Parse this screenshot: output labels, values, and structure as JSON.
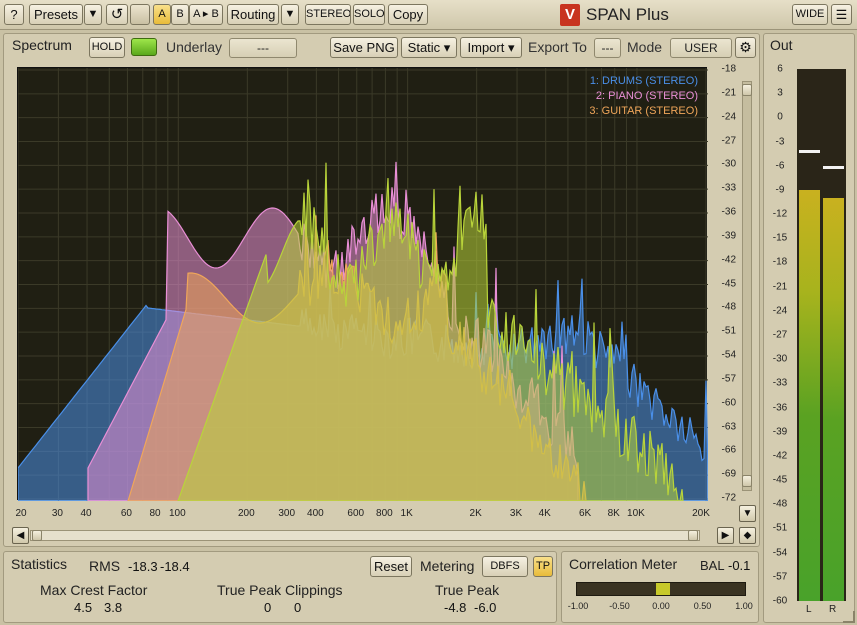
{
  "toolbar": {
    "help_label": "?",
    "presets_label": "Presets",
    "presets_dropdown": "▼",
    "undo_glyph": "↺",
    "a_label": "A",
    "b_label": "B",
    "ab_copy_label": "A ▸ B",
    "routing_label": "Routing",
    "routing_dropdown": "▼",
    "stereo_label": "STEREO",
    "solo_label": "SOLO",
    "copy_label": "Copy",
    "logo_glyph": "V",
    "app_title": "SPAN Plus",
    "wide_label": "WIDE",
    "menu_glyph": "☰"
  },
  "spectrum_panel": {
    "tab_label": "Spectrum",
    "hold_label": "HOLD",
    "underlay_label": "Underlay",
    "underlay_value": "---",
    "save_png_label": "Save PNG",
    "static_label": "Static ▾",
    "import_label": "Import ▾",
    "export_label": "Export To",
    "export_value": "---",
    "mode_label": "Mode",
    "mode_value": "USER",
    "settings_glyph": "⚙"
  },
  "legend": [
    {
      "text": "1: DRUMS (STEREO)",
      "color": "#4a8fe8"
    },
    {
      "text": "2: PIANO (STEREO)",
      "color": "#e98fd6"
    },
    {
      "text": "3: GUITAR (STEREO)",
      "color": "#f0a65a"
    }
  ],
  "db_scale": [
    "-18",
    "-21",
    "-24",
    "-27",
    "-30",
    "-33",
    "-36",
    "-39",
    "-42",
    "-45",
    "-48",
    "-51",
    "-54",
    "-57",
    "-60",
    "-63",
    "-66",
    "-69",
    "-72"
  ],
  "freq_scale": [
    "20",
    "30",
    "40",
    "60",
    "80",
    "100",
    "200",
    "300",
    "400",
    "600",
    "800",
    "1K",
    "2K",
    "3K",
    "4K",
    "6K",
    "8K",
    "10K",
    "20K"
  ],
  "out_panel": {
    "tab_label": "Out",
    "scale": [
      "6",
      "3",
      "0",
      "-3",
      "-6",
      "-9",
      "-12",
      "-15",
      "-18",
      "-21",
      "-24",
      "-27",
      "-30",
      "-33",
      "-36",
      "-39",
      "-42",
      "-45",
      "-48",
      "-51",
      "-54",
      "-57",
      "-60"
    ],
    "left_label": "L",
    "right_label": "R",
    "left_level_db": -9,
    "right_level_db": -10,
    "left_peak_db": -4,
    "right_peak_db": -6
  },
  "statistics": {
    "tab_label": "Statistics",
    "rms_label": "RMS",
    "rms_left": "-18.3",
    "rms_right": "-18.4",
    "reset_label": "Reset",
    "metering_label": "Metering",
    "metering_value": "DBFS",
    "tp_label": "TP",
    "max_crest_label": "Max Crest Factor",
    "max_crest_left": "4.5",
    "max_crest_right": "3.8",
    "tp_clip_label": "True Peak Clippings",
    "tp_clip_left": "0",
    "tp_clip_right": "0",
    "true_peak_label": "True Peak",
    "true_peak_left": "-4.8",
    "true_peak_right": "-6.0"
  },
  "correlation": {
    "tab_label": "Correlation Meter",
    "bal_label": "BAL",
    "bal_value": "-0.1",
    "scale": [
      "-1.00",
      "-0.50",
      "0.00",
      "0.50",
      "1.00"
    ],
    "value": 0.02
  },
  "colors": {
    "drums": "#4a8fe8",
    "piano": "#e98fd6",
    "guitar": "#f0a65a",
    "accent_green": "#9dd435",
    "background": "#c9c1a4"
  }
}
